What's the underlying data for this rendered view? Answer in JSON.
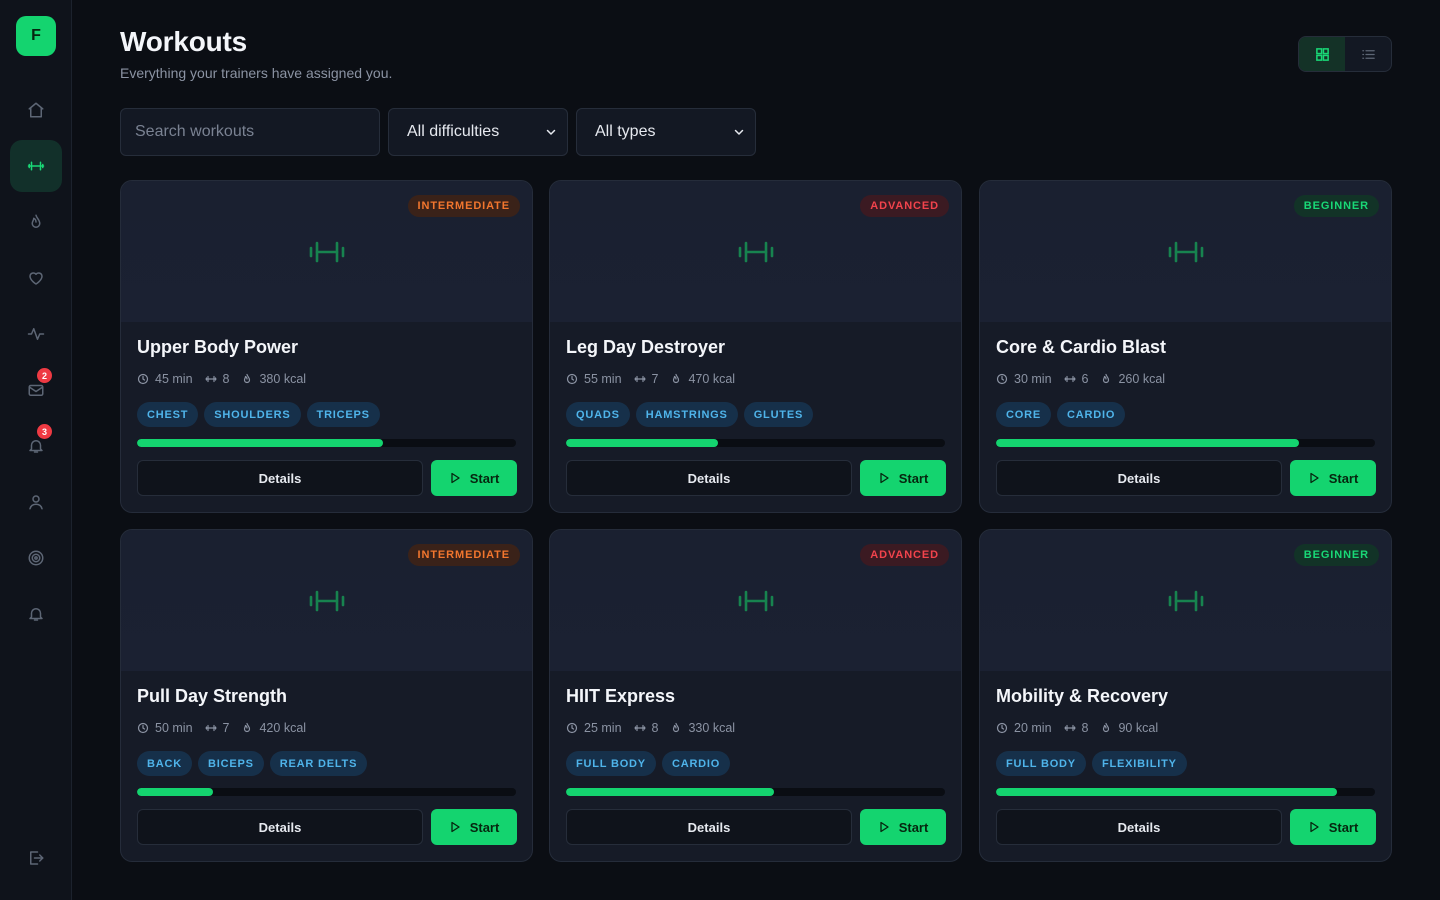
{
  "app": {
    "logo_letter": "F"
  },
  "sidebar": {
    "items": [
      {
        "icon": "home-icon",
        "active": false,
        "badge": ""
      },
      {
        "icon": "dumbbell-icon",
        "active": true,
        "badge": ""
      },
      {
        "icon": "flame-icon",
        "active": false,
        "badge": ""
      },
      {
        "icon": "heart-icon",
        "active": false,
        "badge": ""
      },
      {
        "icon": "activity-icon",
        "active": false,
        "badge": ""
      },
      {
        "icon": "mail-icon",
        "active": false,
        "badge": "2"
      },
      {
        "icon": "bell-icon",
        "active": false,
        "badge": "3"
      },
      {
        "icon": "user-icon",
        "active": false,
        "badge": ""
      },
      {
        "icon": "target-icon",
        "active": false,
        "badge": ""
      },
      {
        "icon": "bell-icon",
        "active": false,
        "badge": ""
      }
    ],
    "logout_icon": "logout-icon"
  },
  "header": {
    "title": "Workouts",
    "subtitle": "Everything your trainers have assigned you.",
    "view_toggle": {
      "active": "grid",
      "options": [
        "grid-icon",
        "list-icon"
      ]
    }
  },
  "filters": {
    "search_placeholder": "Search workouts",
    "difficulty": "All difficulties",
    "type": "All types"
  },
  "actions": {
    "details_label": "Details",
    "start_label": "Start"
  },
  "colors": {
    "accent": "#14d46f",
    "intermediate": "#f2762e",
    "advanced": "#f2434c",
    "beginner": "#19d876",
    "tag_text": "#4fb4ea"
  },
  "workouts": [
    {
      "title": "Upper Body Power",
      "level": "INTERMEDIATE",
      "duration": "45 min",
      "exercises": "8",
      "calories": "380 kcal",
      "tags": [
        "CHEST",
        "SHOULDERS",
        "TRICEPS"
      ],
      "progress": 0.65
    },
    {
      "title": "Leg Day Destroyer",
      "level": "ADVANCED",
      "duration": "55 min",
      "exercises": "7",
      "calories": "470 kcal",
      "tags": [
        "QUADS",
        "HAMSTRINGS",
        "GLUTES"
      ],
      "progress": 0.4
    },
    {
      "title": "Core & Cardio Blast",
      "level": "BEGINNER",
      "duration": "30 min",
      "exercises": "6",
      "calories": "260 kcal",
      "tags": [
        "CORE",
        "CARDIO"
      ],
      "progress": 0.8
    },
    {
      "title": "Pull Day Strength",
      "level": "INTERMEDIATE",
      "duration": "50 min",
      "exercises": "7",
      "calories": "420 kcal",
      "tags": [
        "BACK",
        "BICEPS",
        "REAR DELTS"
      ],
      "progress": 0.2
    },
    {
      "title": "HIIT Express",
      "level": "ADVANCED",
      "duration": "25 min",
      "exercises": "8",
      "calories": "330 kcal",
      "tags": [
        "FULL BODY",
        "CARDIO"
      ],
      "progress": 0.55
    },
    {
      "title": "Mobility & Recovery",
      "level": "BEGINNER",
      "duration": "20 min",
      "exercises": "8",
      "calories": "90 kcal",
      "tags": [
        "FULL BODY",
        "FLEXIBILITY"
      ],
      "progress": 0.9
    }
  ]
}
